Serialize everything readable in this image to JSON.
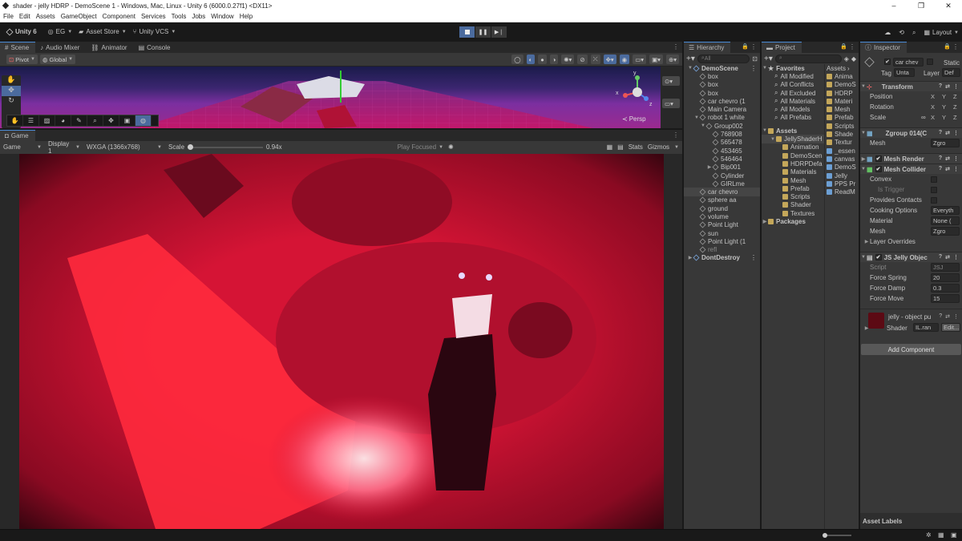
{
  "window": {
    "title": "shader - jelly HDRP - DemoScene 1 - Windows, Mac, Linux - Unity 6 (6000.0.27f1) <DX11>",
    "controls": [
      "–",
      "❐",
      "✕"
    ]
  },
  "menu": [
    "File",
    "Edit",
    "Assets",
    "GameObject",
    "Component",
    "Services",
    "Tools",
    "Jobs",
    "Window",
    "Help"
  ],
  "toolbar": {
    "unity": "Unity 6",
    "account": "EG",
    "asset_store": "Asset Store",
    "vcs": "Unity VCS",
    "layout": "Layout"
  },
  "scene": {
    "tabs": [
      "Scene",
      "Audio Mixer",
      "Animator",
      "Console"
    ],
    "pivot": "Pivot",
    "global": "Global",
    "persp": "Persp",
    "axes": {
      "x": "x",
      "y": "y",
      "z": "z"
    }
  },
  "game": {
    "tab": "Game",
    "display_mode": "Game",
    "display": "Display 1",
    "resolution": "WXGA (1366x768)",
    "scale_label": "Scale",
    "scale_value": "0.94x",
    "play_focused": "Play Focused",
    "stats": "Stats",
    "gizmos": "Gizmos"
  },
  "hierarchy": {
    "tab": "Hierarchy",
    "search": "All",
    "items": [
      {
        "label": "DemoScene",
        "depth": 0,
        "bold": true
      },
      {
        "label": "box",
        "depth": 1
      },
      {
        "label": "box",
        "depth": 1
      },
      {
        "label": "box",
        "depth": 1
      },
      {
        "label": "car chevro (1",
        "depth": 1
      },
      {
        "label": "Main Camera",
        "depth": 1
      },
      {
        "label": "robot 1 white",
        "depth": 1
      },
      {
        "label": "Group002",
        "depth": 2
      },
      {
        "label": "768908",
        "depth": 3
      },
      {
        "label": "565478",
        "depth": 3
      },
      {
        "label": "453465",
        "depth": 3
      },
      {
        "label": "546464",
        "depth": 3
      },
      {
        "label": "Bip001",
        "depth": 3
      },
      {
        "label": "Cylinder",
        "depth": 3
      },
      {
        "label": "GIRLme",
        "depth": 3
      },
      {
        "label": "car chevro",
        "depth": 1,
        "selected": true
      },
      {
        "label": "sphere aa",
        "depth": 1
      },
      {
        "label": "ground",
        "depth": 1
      },
      {
        "label": "volume",
        "depth": 1
      },
      {
        "label": "Point Light",
        "depth": 1
      },
      {
        "label": "sun",
        "depth": 1
      },
      {
        "label": "Point Light (1",
        "depth": 1
      },
      {
        "label": "refl",
        "depth": 1
      },
      {
        "label": "DontDestroy",
        "depth": 0,
        "bold": true
      }
    ]
  },
  "project": {
    "tab": "Project",
    "favorites_label": "Favorites",
    "favorites": [
      "All Modified",
      "All Conflicts",
      "All Excluded",
      "All Materials",
      "All Models",
      "All Prefabs"
    ],
    "assets_label": "Assets",
    "tree": [
      {
        "label": "JellyShaderH",
        "depth": 1
      },
      {
        "label": "Animation",
        "depth": 2
      },
      {
        "label": "DemoScen",
        "depth": 2
      },
      {
        "label": "HDRPDefa",
        "depth": 2
      },
      {
        "label": "Materials",
        "depth": 2
      },
      {
        "label": "Mesh",
        "depth": 2
      },
      {
        "label": "Prefab",
        "depth": 2
      },
      {
        "label": "Scripts",
        "depth": 2
      },
      {
        "label": "Shader",
        "depth": 2
      },
      {
        "label": "Textures",
        "depth": 2
      }
    ],
    "packages_label": "Packages",
    "breadcrumb": "Assets",
    "files": [
      "Anima",
      "DemoS",
      "HDRP",
      "Materi",
      "Mesh",
      "Prefab",
      "Scripts",
      "Shade",
      "Textur",
      "_essen",
      "canvas",
      "DemoS",
      "Jelly",
      "PPS Pr",
      "ReadM"
    ]
  },
  "inspector": {
    "tab": "Inspector",
    "object_name": "car chev",
    "static": "Static",
    "tag_label": "Tag",
    "tag": "Unta",
    "layer_label": "Layer",
    "layer": "Def",
    "transform": {
      "title": "Transform",
      "position": "Position",
      "rotation": "Rotation",
      "scale": "Scale",
      "axes": [
        "X",
        "Y",
        "Z"
      ]
    },
    "mesh_filter": {
      "title": "Zgroup 014(C",
      "mesh_label": "Mesh",
      "mesh": "Zgro"
    },
    "mesh_renderer": {
      "title": "Mesh Render"
    },
    "mesh_collider": {
      "title": "Mesh Collider",
      "convex": "Convex",
      "is_trigger": "Is Trigger",
      "provides_contacts": "Provides Contacts",
      "cooking": "Cooking Options",
      "cooking_value": "Everyth",
      "material": "Material",
      "material_value": "None (",
      "mesh": "Mesh",
      "mesh_value": "Zgro",
      "layer_overrides": "Layer Overrides"
    },
    "jelly": {
      "title": "JS Jelly Objec",
      "script": "Script",
      "script_value": "JSJ",
      "spring": "Force Spring",
      "spring_value": "20",
      "damp": "Force Damp",
      "damp_value": "0.3",
      "move": "Force Move",
      "move_value": "15"
    },
    "material": {
      "title": "jelly - object pu",
      "shader_label": "Shader",
      "shader": "IL.ran",
      "edit": "Edit..."
    },
    "add_component": "Add Component",
    "asset_labels": "Asset Labels"
  },
  "colors": {
    "accent": "#4a8bd6",
    "game_red": "#c3122f"
  }
}
